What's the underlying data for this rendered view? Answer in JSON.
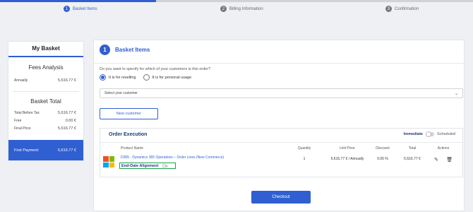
{
  "progress": {
    "fraction": 0.33
  },
  "steps": [
    {
      "num": "1",
      "label": "Basket Items",
      "active": true
    },
    {
      "num": "2",
      "label": "Billing Information",
      "active": false
    },
    {
      "num": "3",
      "label": "Confirmation",
      "active": false
    }
  ],
  "basket": {
    "title": "My Basket",
    "fees_title": "Fees Analysis",
    "annually_label": "Annually",
    "annually_value": "5,616.77 €",
    "total_title": "Basket Total",
    "rows": [
      {
        "label": "Total Before Tax",
        "value": "5,616.77 €"
      },
      {
        "label": "Free",
        "value": "0.00 €"
      },
      {
        "label": "Final Price",
        "value": "5,616.77 €"
      }
    ],
    "first_payment_label": "First Payment:",
    "first_payment_value": "5,616.77 €"
  },
  "main": {
    "step_num": "1",
    "title": "Basket Items",
    "question": "Do you want to specify for which of your customers is this order?",
    "radio_resell": "It is for reselling",
    "radio_usage": "It is for personal usage",
    "select_placeholder": "Select your customer",
    "new_customer": "New customer",
    "exec_title": "Order Execution",
    "immediate": "Immediate",
    "scheduled": "Scheduled",
    "columns": {
      "name": "Product Name",
      "qty": "Quantity",
      "unit": "Unit Price",
      "disc": "Discount",
      "total": "Total",
      "act": "Actions"
    },
    "row": {
      "name": "D365 - Dynamics 365 Operations – Order Lines (New Commerce)",
      "end_date": "End-Date Alignment",
      "qty": "1",
      "unit": "5,616.77 € / Annually",
      "disc": "0.00 %",
      "total": "5,616.77 €"
    },
    "checkout": "Checkout"
  },
  "colors": {
    "accent": "#2f5fd0",
    "highlight": "#1aa34a",
    "ms_red": "#f25022",
    "ms_green": "#7fba00",
    "ms_blue": "#00a4ef",
    "ms_yellow": "#ffb900"
  },
  "icons": [
    "pencil-icon",
    "trash-icon",
    "chevron-down-icon",
    "microsoft-logo"
  ]
}
